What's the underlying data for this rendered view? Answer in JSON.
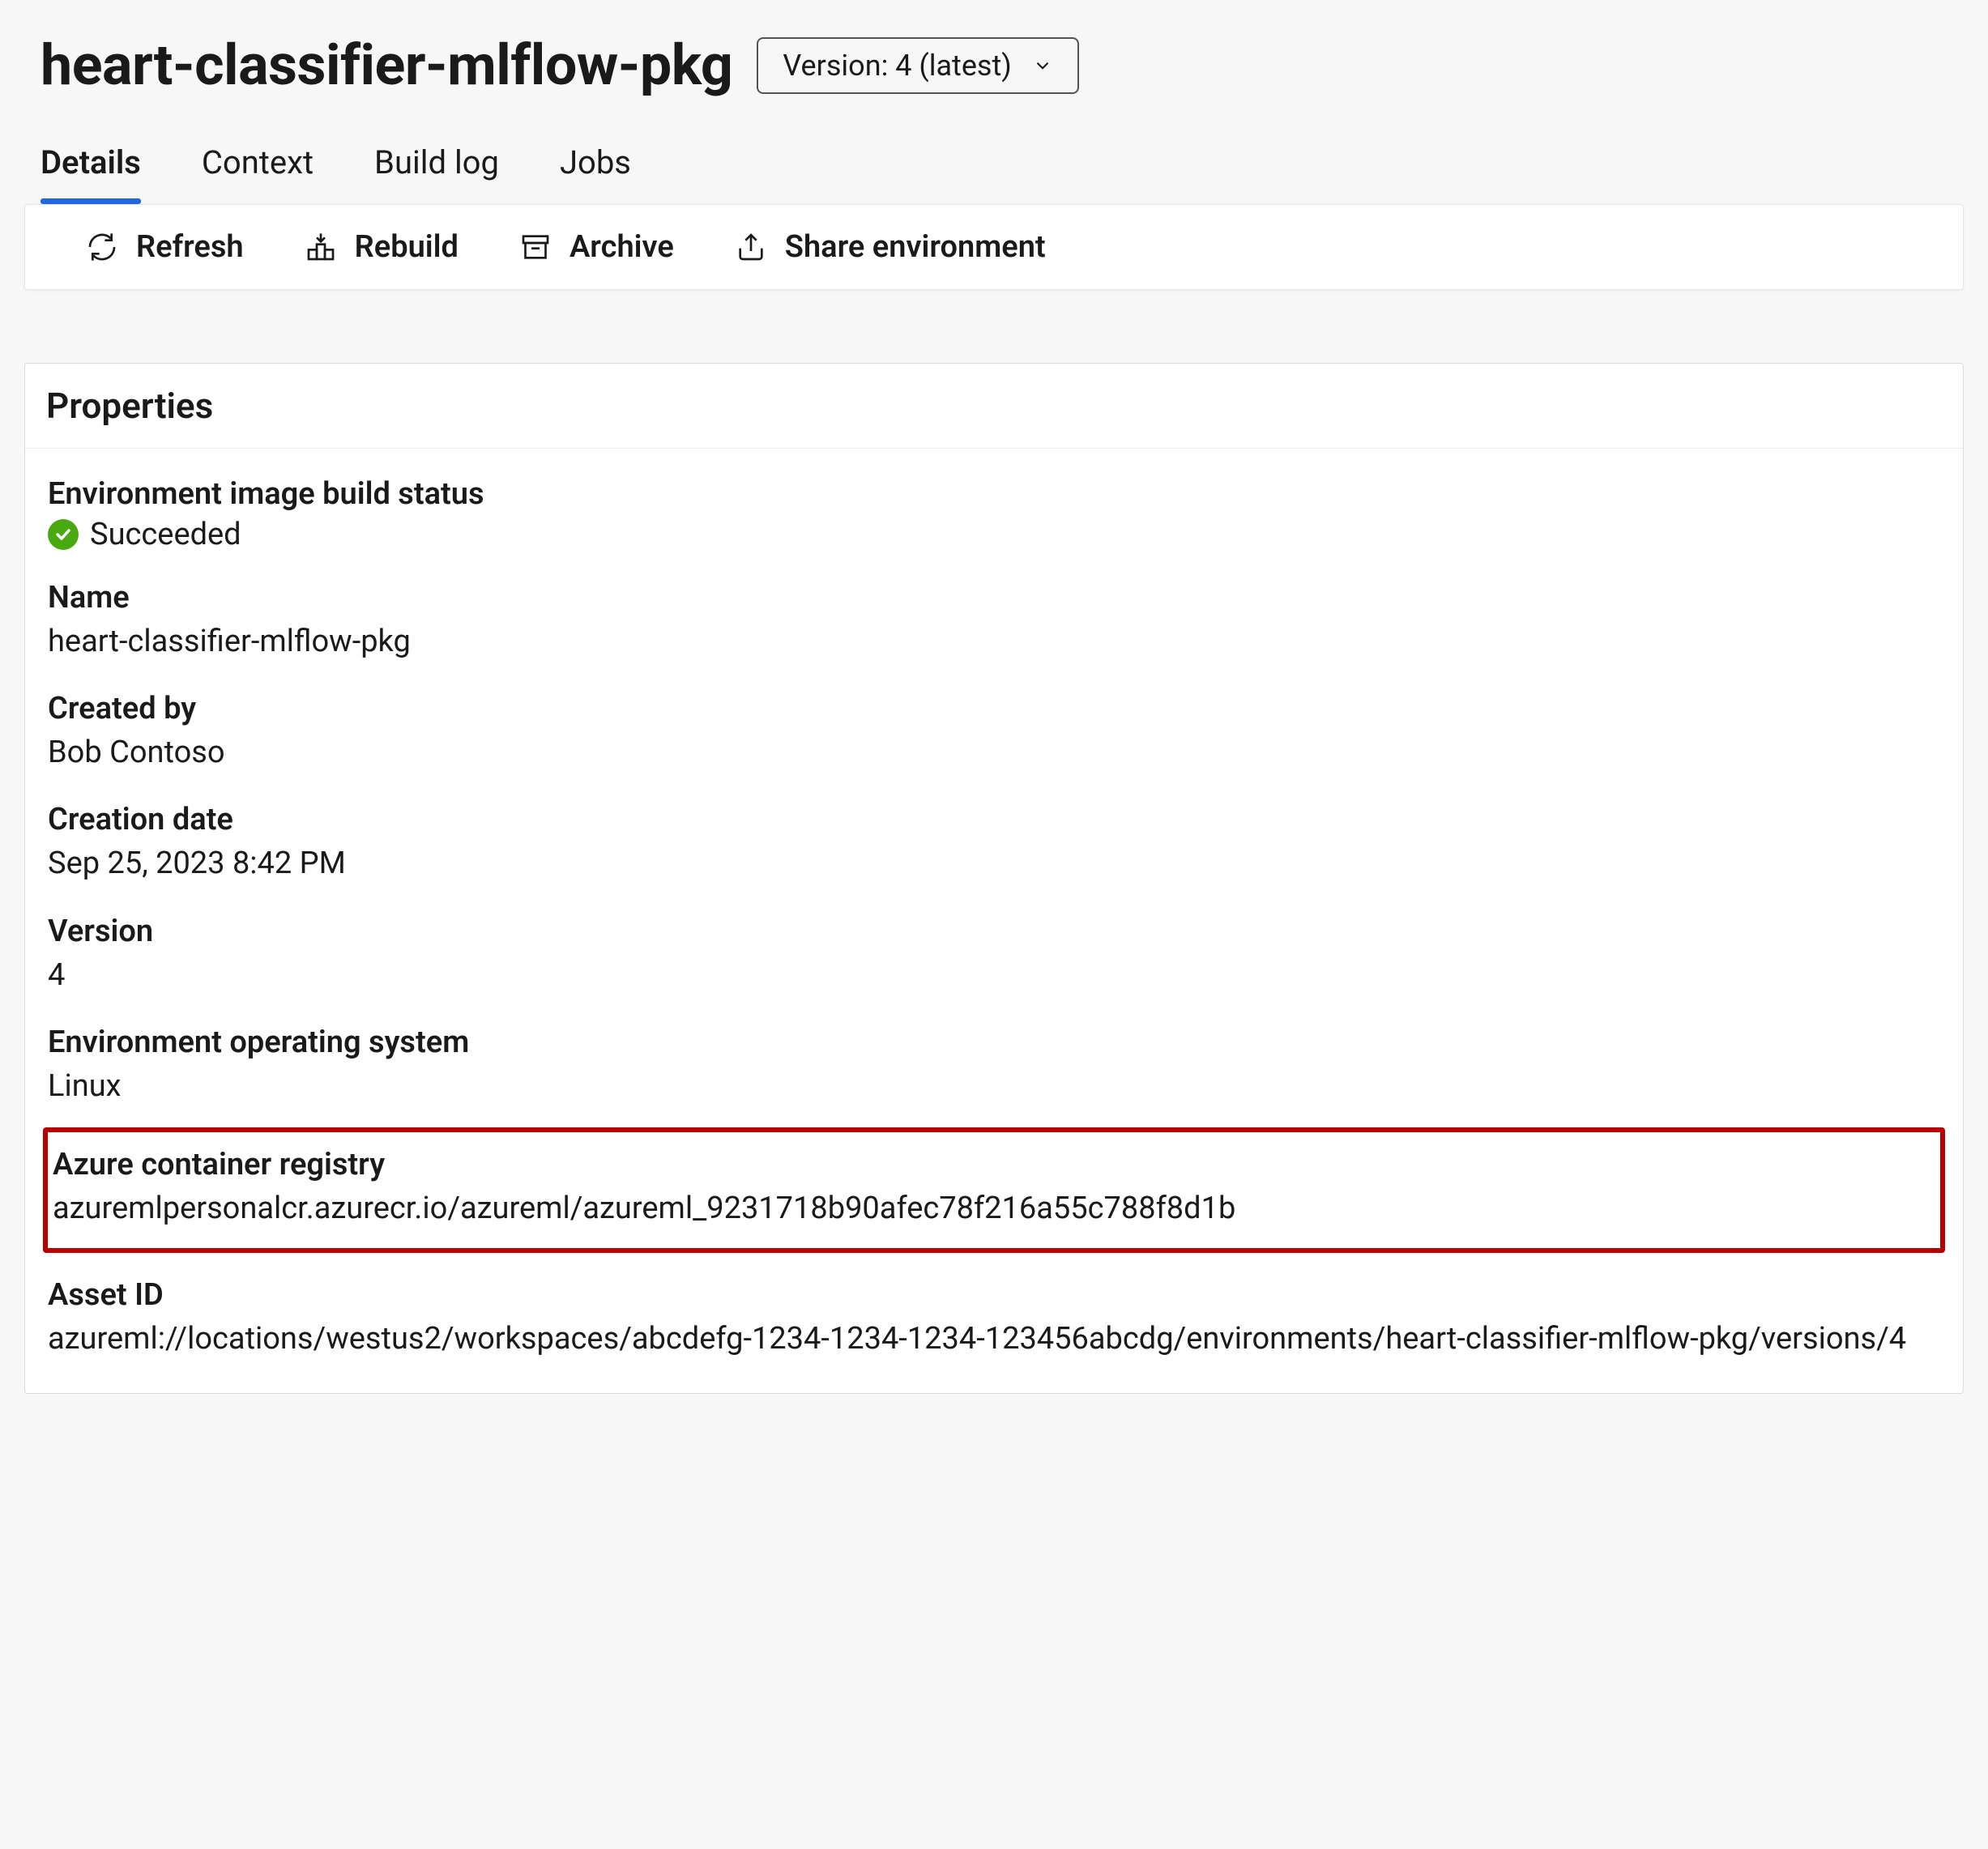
{
  "header": {
    "title": "heart-classifier-mlflow-pkg",
    "version_select_label": "Version: 4 (latest)"
  },
  "tabs": [
    {
      "label": "Details",
      "active": true
    },
    {
      "label": "Context",
      "active": false
    },
    {
      "label": "Build log",
      "active": false
    },
    {
      "label": "Jobs",
      "active": false
    }
  ],
  "toolbar": {
    "refresh": "Refresh",
    "rebuild": "Rebuild",
    "archive": "Archive",
    "share": "Share environment"
  },
  "properties": {
    "card_title": "Properties",
    "status_label": "Environment image build status",
    "status_value": "Succeeded",
    "name_label": "Name",
    "name_value": "heart-classifier-mlflow-pkg",
    "created_by_label": "Created by",
    "created_by_value": "Bob Contoso",
    "creation_date_label": "Creation date",
    "creation_date_value": "Sep 25, 2023 8:42 PM",
    "version_label": "Version",
    "version_value": "4",
    "os_label": "Environment operating system",
    "os_value": "Linux",
    "acr_label": "Azure container registry",
    "acr_value": "azuremlpersonalcr.azurecr.io/azureml/azureml_9231718b90afec78f216a55c788f8d1b",
    "asset_id_label": "Asset ID",
    "asset_id_value": "azureml://locations/westus2/workspaces/abcdefg-1234-1234-1234-123456abcdg/environments/heart-classifier-mlflow-pkg/versions/4"
  }
}
